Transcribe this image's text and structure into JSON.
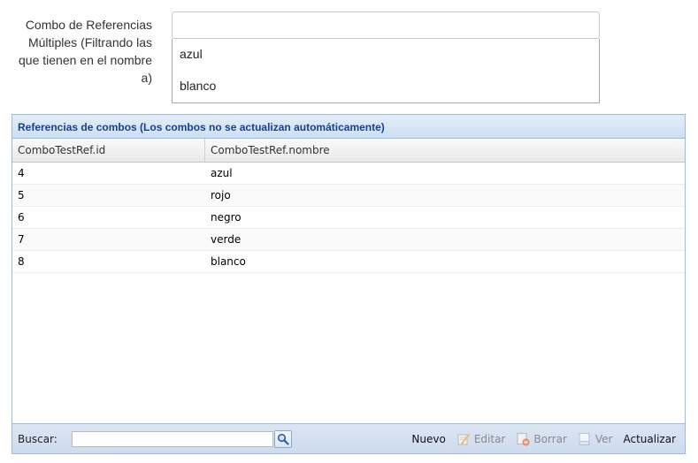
{
  "form": {
    "label": "Combo de Referencias Múltiples (Filtrando las que tienen en el nombre a)",
    "input_value": "",
    "options": [
      "azul",
      "blanco"
    ]
  },
  "grid": {
    "title": "Referencias de combos (Los combos no se actualizan automáticamente)",
    "columns": [
      "ComboTestRef.id",
      "ComboTestRef.nombre"
    ],
    "rows": [
      {
        "id": "4",
        "nombre": "azul"
      },
      {
        "id": "5",
        "nombre": "rojo"
      },
      {
        "id": "6",
        "nombre": "negro"
      },
      {
        "id": "7",
        "nombre": "verde"
      },
      {
        "id": "8",
        "nombre": "blanco"
      }
    ]
  },
  "toolbar": {
    "search_label": "Buscar:",
    "search_value": "",
    "search_icon": "magnifier-icon",
    "buttons": [
      {
        "label": "Nuevo",
        "icon": "none",
        "enabled": true
      },
      {
        "label": "Editar",
        "icon": "edit-icon",
        "enabled": false
      },
      {
        "label": "Borrar",
        "icon": "delete-icon",
        "enabled": false
      },
      {
        "label": "Ver",
        "icon": "view-icon",
        "enabled": false
      },
      {
        "label": "Actualizar",
        "icon": "none",
        "enabled": true
      }
    ]
  },
  "colors": {
    "panel_border": "#99bbe8",
    "title_text": "#15428b",
    "toolbar_bg": "#cedbee"
  }
}
